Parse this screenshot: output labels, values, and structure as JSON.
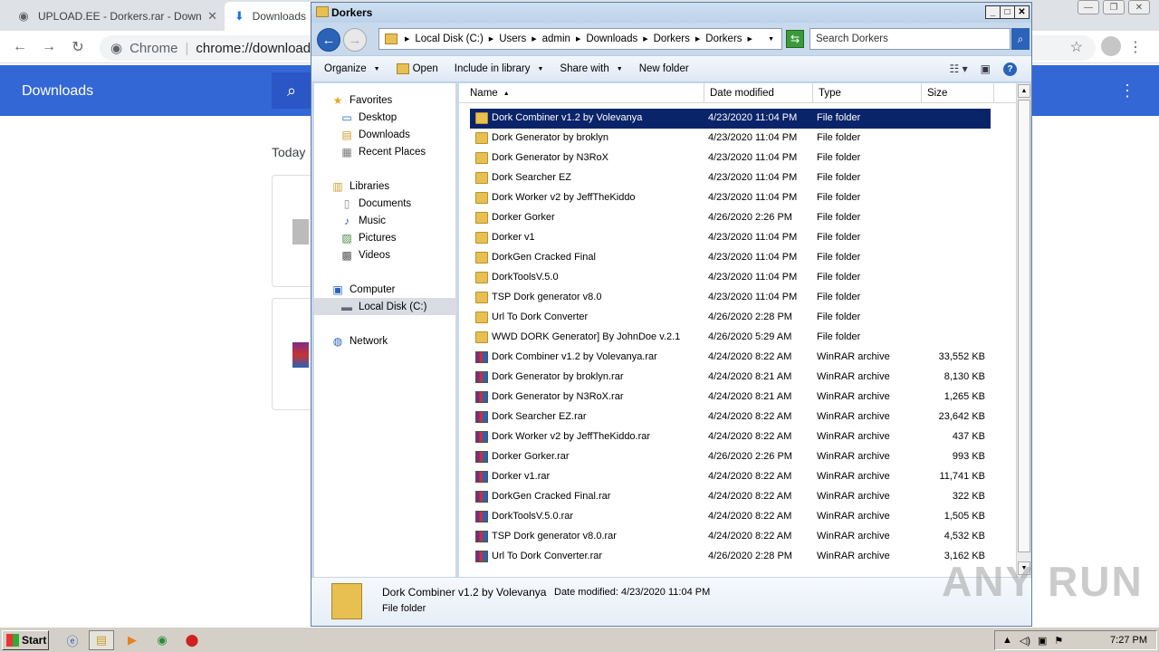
{
  "browser": {
    "tabs": [
      {
        "title": "UPLOAD.EE - Dorkers.rar - Download"
      },
      {
        "title": "Downloads"
      }
    ],
    "omnibox": {
      "site": "Chrome",
      "url": "chrome://downloads"
    },
    "downloads_title": "Downloads",
    "today_label": "Today"
  },
  "explorer": {
    "title": "Dorkers",
    "breadcrumbs": [
      "Local Disk (C:)",
      "Users",
      "admin",
      "Downloads",
      "Dorkers",
      "Dorkers"
    ],
    "search_placeholder": "Search Dorkers",
    "commands": {
      "organize": "Organize",
      "open": "Open",
      "include": "Include in library",
      "share": "Share with",
      "new_folder": "New folder"
    },
    "nav": {
      "favorites": "Favorites",
      "desktop": "Desktop",
      "downloads": "Downloads",
      "recent": "Recent Places",
      "libraries": "Libraries",
      "documents": "Documents",
      "music": "Music",
      "pictures": "Pictures",
      "videos": "Videos",
      "computer": "Computer",
      "local_disk": "Local Disk (C:)",
      "network": "Network"
    },
    "columns": {
      "name": "Name",
      "date": "Date modified",
      "type": "Type",
      "size": "Size"
    },
    "files": [
      {
        "name": "Dork Combiner v1.2 by Volevanya",
        "date": "4/23/2020 11:04 PM",
        "type": "File folder",
        "size": "",
        "kind": "folder"
      },
      {
        "name": "Dork Generator by broklyn",
        "date": "4/23/2020 11:04 PM",
        "type": "File folder",
        "size": "",
        "kind": "folder"
      },
      {
        "name": "Dork Generator by N3RoX",
        "date": "4/23/2020 11:04 PM",
        "type": "File folder",
        "size": "",
        "kind": "folder"
      },
      {
        "name": "Dork Searcher EZ",
        "date": "4/23/2020 11:04 PM",
        "type": "File folder",
        "size": "",
        "kind": "folder"
      },
      {
        "name": "Dork Worker v2 by JeffTheKiddo",
        "date": "4/23/2020 11:04 PM",
        "type": "File folder",
        "size": "",
        "kind": "folder"
      },
      {
        "name": "Dorker Gorker",
        "date": "4/26/2020 2:26 PM",
        "type": "File folder",
        "size": "",
        "kind": "folder"
      },
      {
        "name": "Dorker v1",
        "date": "4/23/2020 11:04 PM",
        "type": "File folder",
        "size": "",
        "kind": "folder"
      },
      {
        "name": "DorkGen Cracked Final",
        "date": "4/23/2020 11:04 PM",
        "type": "File folder",
        "size": "",
        "kind": "folder"
      },
      {
        "name": "DorkToolsV.5.0",
        "date": "4/23/2020 11:04 PM",
        "type": "File folder",
        "size": "",
        "kind": "folder"
      },
      {
        "name": "TSP Dork generator v8.0",
        "date": "4/23/2020 11:04 PM",
        "type": "File folder",
        "size": "",
        "kind": "folder"
      },
      {
        "name": "Url To Dork Converter",
        "date": "4/26/2020 2:28 PM",
        "type": "File folder",
        "size": "",
        "kind": "folder"
      },
      {
        "name": "WWD DORK Generator] By JohnDoe v.2.1",
        "date": "4/26/2020 5:29 AM",
        "type": "File folder",
        "size": "",
        "kind": "folder"
      },
      {
        "name": "Dork Combiner v1.2 by Volevanya.rar",
        "date": "4/24/2020 8:22 AM",
        "type": "WinRAR archive",
        "size": "33,552 KB",
        "kind": "rar"
      },
      {
        "name": "Dork Generator by broklyn.rar",
        "date": "4/24/2020 8:21 AM",
        "type": "WinRAR archive",
        "size": "8,130 KB",
        "kind": "rar"
      },
      {
        "name": "Dork Generator by N3RoX.rar",
        "date": "4/24/2020 8:21 AM",
        "type": "WinRAR archive",
        "size": "1,265 KB",
        "kind": "rar"
      },
      {
        "name": "Dork Searcher EZ.rar",
        "date": "4/24/2020 8:22 AM",
        "type": "WinRAR archive",
        "size": "23,642 KB",
        "kind": "rar"
      },
      {
        "name": "Dork Worker v2 by JeffTheKiddo.rar",
        "date": "4/24/2020 8:22 AM",
        "type": "WinRAR archive",
        "size": "437 KB",
        "kind": "rar"
      },
      {
        "name": "Dorker Gorker.rar",
        "date": "4/26/2020 2:26 PM",
        "type": "WinRAR archive",
        "size": "993 KB",
        "kind": "rar"
      },
      {
        "name": "Dorker v1.rar",
        "date": "4/24/2020 8:22 AM",
        "type": "WinRAR archive",
        "size": "11,741 KB",
        "kind": "rar"
      },
      {
        "name": "DorkGen Cracked Final.rar",
        "date": "4/24/2020 8:22 AM",
        "type": "WinRAR archive",
        "size": "322 KB",
        "kind": "rar"
      },
      {
        "name": "DorkToolsV.5.0.rar",
        "date": "4/24/2020 8:22 AM",
        "type": "WinRAR archive",
        "size": "1,505 KB",
        "kind": "rar"
      },
      {
        "name": "TSP Dork generator v8.0.rar",
        "date": "4/24/2020 8:22 AM",
        "type": "WinRAR archive",
        "size": "4,532 KB",
        "kind": "rar"
      },
      {
        "name": "Url To Dork Converter.rar",
        "date": "4/26/2020 2:28 PM",
        "type": "WinRAR archive",
        "size": "3,162 KB",
        "kind": "rar"
      }
    ],
    "details": {
      "name": "Dork Combiner v1.2 by Volevanya",
      "date_modified": "Date modified: 4/23/2020 11:04 PM",
      "type": "File folder"
    }
  },
  "watermark": "ANY RUN",
  "taskbar": {
    "start": "Start",
    "clock": "7:27 PM"
  }
}
